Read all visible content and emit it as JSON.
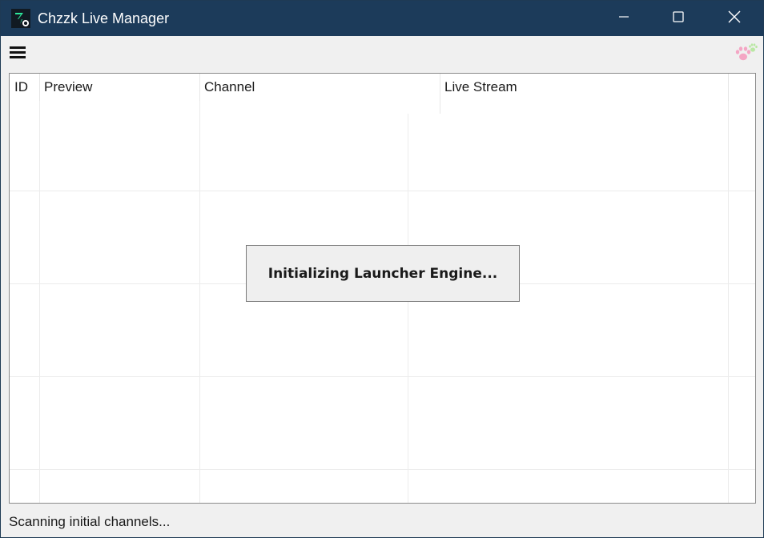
{
  "window": {
    "title": "Chzzk Live Manager",
    "titlebar_color": "#1c3b5a",
    "icons": {
      "app": "chzzk-logo-icon",
      "minimize": "minimize-icon",
      "maximize": "maximize-icon",
      "close": "close-icon"
    }
  },
  "toolbar": {
    "menu_icon": "hamburger-menu-icon",
    "decor_icon": "paw-print-icon"
  },
  "table": {
    "columns": [
      "ID",
      "Preview",
      "Channel",
      "Live Stream"
    ],
    "rows": []
  },
  "overlay": {
    "message": "Initializing Launcher Engine..."
  },
  "status": {
    "text": "Scanning initial channels..."
  },
  "colors": {
    "accent_green": "#2ee89a",
    "paw_pink": "#f4a6c4",
    "paw_green": "#b9e8a4"
  }
}
